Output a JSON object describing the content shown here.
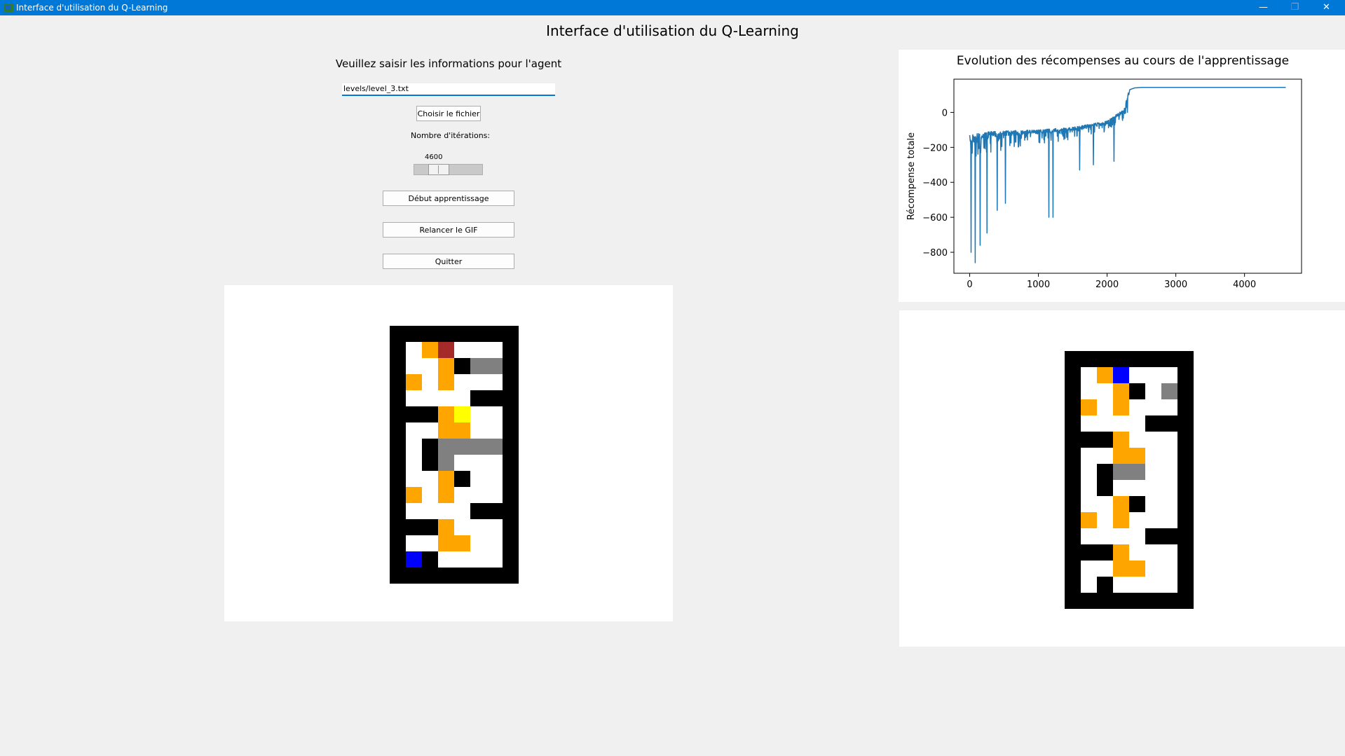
{
  "window": {
    "title": "Interface d'utilisation du Q-Learning",
    "minimize_glyph": "—",
    "maximize_glyph": "❐",
    "close_glyph": "✕",
    "accent": "#0078d7"
  },
  "header": {
    "title": "Interface d'utilisation du Q-Learning"
  },
  "form": {
    "subtitle": "Veuillez saisir les informations pour l'agent",
    "file_value": "levels/level_3.txt",
    "choose_file_label": "Choisir le fichier",
    "iterations_label": "Nombre d'itérations:",
    "iterations_value": "4600",
    "iterations_fraction": 0.3,
    "start_label": "Début apprentissage",
    "replay_gif_label": "Relancer le GIF",
    "quit_label": "Quitter"
  },
  "colors": {
    "wall": "#000000",
    "floor": "#ffffff",
    "orange": "#ffa500",
    "gray": "#808080",
    "blue": "#0000ff",
    "red": "#a52a2a",
    "yellow": "#ffff00"
  },
  "maze_left": [
    "WWWWWWWW",
    "WFOBFFFW",
    "WFFOWGGW",
    "WOFOFFFW",
    "WFFFFWWW",
    "WWWOYFFW",
    "WFFOOFFW",
    "WFWGGGGW",
    "WFWGFFFW",
    "WFFOWFFW",
    "WOFOFFFW",
    "WFFFFWWW",
    "WWWOFFFW",
    "WFFOOFFW",
    "WLWFFFFW",
    "WWWWWWWW"
  ],
  "maze_right": [
    "WWWWWWWW",
    "WFOLFFFW",
    "WFFOWFGW",
    "WOFOFFFW",
    "WFFFFWWW",
    "WWWOFFFW",
    "WFFOOFFW",
    "WFWGGFFW",
    "WFWFFFFW",
    "WFFOWFFW",
    "WOFOFFFW",
    "WFFFFWWW",
    "WWWOFFFW",
    "WFFOOFFW",
    "WFWFFFFW",
    "WWWWWWWW"
  ],
  "chart_data": {
    "type": "line",
    "title": "Evolution des récompenses au cours de l'apprentissage",
    "xlabel": "",
    "ylabel": "Récompense totale",
    "xlim": [
      -230,
      4830
    ],
    "ylim": [
      -920,
      190
    ],
    "xticks": [
      0,
      1000,
      2000,
      3000,
      4000
    ],
    "yticks": [
      0,
      -200,
      -400,
      -600,
      -800
    ],
    "xtick_labels": [
      "0",
      "1000",
      "2000",
      "3000",
      "4000"
    ],
    "ytick_labels": [
      "0",
      "−200",
      "−400",
      "−600",
      "−800"
    ],
    "grid": false,
    "color": "#1f77b4",
    "series": [
      {
        "x": [
          0,
          2320,
          2330,
          2400,
          2500,
          3000,
          4000,
          4600
        ],
        "y": [
          -200,
          -130,
          130,
          140,
          143,
          143,
          143,
          143
        ]
      }
    ],
    "noise_band": {
      "x": [
        0,
        100,
        300,
        600,
        1000,
        1500,
        2000,
        2250,
        2320
      ],
      "lower": [
        -800,
        -700,
        -520,
        -440,
        -370,
        -320,
        -260,
        -230,
        -210
      ],
      "upper": [
        -130,
        -120,
        -110,
        -105,
        -100,
        -85,
        -50,
        20,
        130
      ]
    },
    "spikes": [
      {
        "x": 20,
        "y": -800
      },
      {
        "x": 80,
        "y": -860
      },
      {
        "x": 150,
        "y": -760
      },
      {
        "x": 250,
        "y": -690
      },
      {
        "x": 400,
        "y": -560
      },
      {
        "x": 520,
        "y": -520
      },
      {
        "x": 1150,
        "y": -600
      },
      {
        "x": 1210,
        "y": -600
      },
      {
        "x": 1600,
        "y": -330
      },
      {
        "x": 1800,
        "y": -300
      },
      {
        "x": 2100,
        "y": -280
      }
    ]
  }
}
